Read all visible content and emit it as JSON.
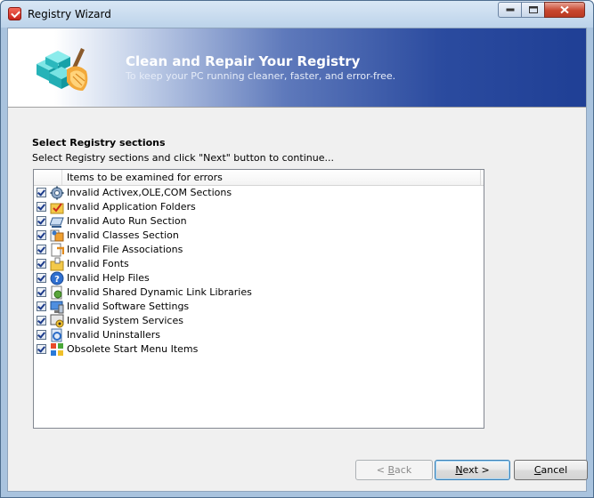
{
  "window": {
    "title": "Registry Wizard"
  },
  "banner": {
    "title": "Clean and Repair Your Registry",
    "subtitle": "To keep your PC running cleaner, faster, and error-free."
  },
  "section": {
    "title": "Select Registry sections",
    "description": "Select Registry sections and click \"Next\" button to continue..."
  },
  "list": {
    "header": "Items to be examined for errors",
    "items": [
      {
        "label": "Invalid Activex,OLE,COM Sections",
        "checked": true,
        "icon": "gear-icon"
      },
      {
        "label": "Invalid Application Folders",
        "checked": true,
        "icon": "folder-check-icon"
      },
      {
        "label": "Invalid Auto Run Section",
        "checked": true,
        "icon": "autorun-icon"
      },
      {
        "label": "Invalid Classes Section",
        "checked": true,
        "icon": "classes-icon"
      },
      {
        "label": "Invalid File Associations",
        "checked": true,
        "icon": "file-association-icon"
      },
      {
        "label": "Invalid Fonts",
        "checked": true,
        "icon": "font-folder-icon"
      },
      {
        "label": "Invalid Help Files",
        "checked": true,
        "icon": "help-icon"
      },
      {
        "label": "Invalid Shared Dynamic Link Libraries",
        "checked": true,
        "icon": "dll-icon"
      },
      {
        "label": "Invalid Software Settings",
        "checked": true,
        "icon": "software-settings-icon"
      },
      {
        "label": "Invalid System Services",
        "checked": true,
        "icon": "services-icon"
      },
      {
        "label": "Invalid Uninstallers",
        "checked": true,
        "icon": "uninstaller-icon"
      },
      {
        "label": "Obsolete Start Menu Items",
        "checked": true,
        "icon": "start-menu-icon"
      }
    ]
  },
  "buttons": {
    "back_prefix": "< ",
    "back_key": "B",
    "back_rest": "ack",
    "next_key": "N",
    "next_rest": "ext >",
    "cancel_key": "C",
    "cancel_rest": "ancel"
  }
}
